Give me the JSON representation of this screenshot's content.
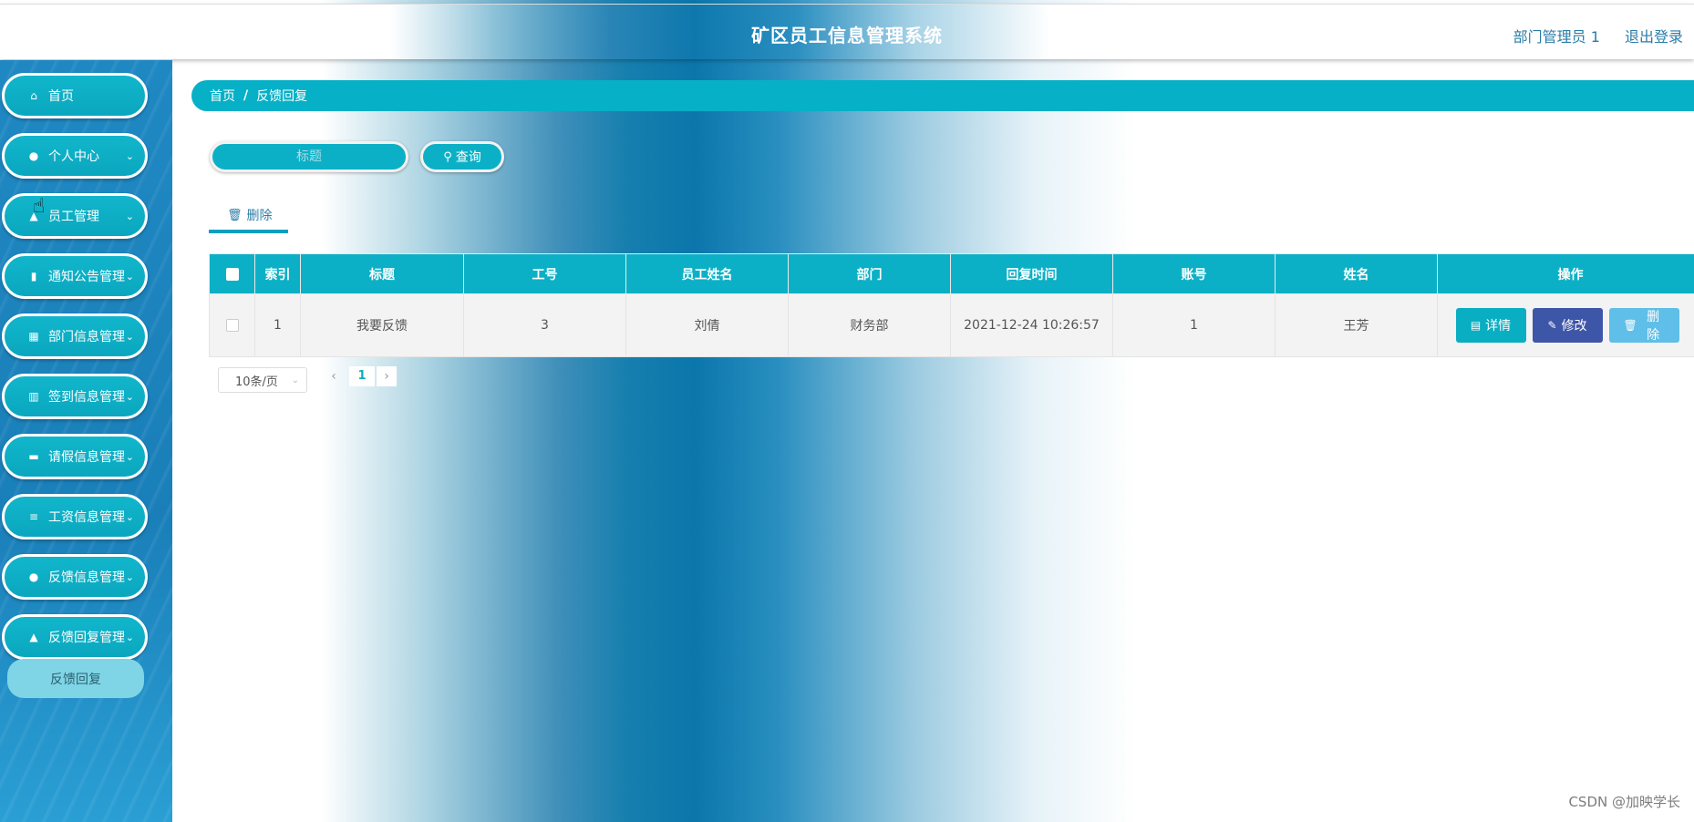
{
  "header": {
    "title": "矿区员工信息管理系统",
    "user": "部门管理员 1",
    "logout": "退出登录"
  },
  "sidebar": {
    "items": [
      {
        "label": "首页",
        "icon": "home-icon",
        "glyph": "⌂",
        "chevron": ""
      },
      {
        "label": "个人中心",
        "icon": "user-icon",
        "glyph": "●",
        "chevron": "⌄"
      },
      {
        "label": "员工管理",
        "icon": "users-icon",
        "glyph": "▲",
        "chevron": "⌄"
      },
      {
        "label": "通知公告管理",
        "icon": "clipboard-icon",
        "glyph": "▮",
        "chevron": "⌄"
      },
      {
        "label": "部门信息管理",
        "icon": "grid-icon",
        "glyph": "▦",
        "chevron": "⌄"
      },
      {
        "label": "签到信息管理",
        "icon": "bar-chart-icon",
        "glyph": "▥",
        "chevron": "⌄"
      },
      {
        "label": "请假信息管理",
        "icon": "briefcase-icon",
        "glyph": "▬",
        "chevron": "⌄"
      },
      {
        "label": "工资信息管理",
        "icon": "sliders-icon",
        "glyph": "≡",
        "chevron": "⌄"
      },
      {
        "label": "反馈信息管理",
        "icon": "bulb-icon",
        "glyph": "●",
        "chevron": "⌄"
      },
      {
        "label": "反馈回复管理",
        "icon": "person-icon",
        "glyph": "▲",
        "chevron": "⌄"
      }
    ],
    "submenu": {
      "label": "反馈回复"
    }
  },
  "breadcrumb": {
    "home": "首页",
    "separator": "/",
    "current": "反馈回复"
  },
  "search": {
    "placeholder": "标题",
    "value": "",
    "button_label": "查询"
  },
  "actions": {
    "delete_label": "删除"
  },
  "table": {
    "headers": [
      "索引",
      "标题",
      "工号",
      "员工姓名",
      "部门",
      "回复时间",
      "账号",
      "姓名",
      "操作"
    ],
    "rows": [
      {
        "index": "1",
        "title": "我要反馈",
        "employee_no": "3",
        "employee_name": "刘倩",
        "department": "财务部",
        "reply_time": "2021-12-24 10:26:57",
        "account": "1",
        "name": "王芳"
      }
    ],
    "row_actions": {
      "detail": "详情",
      "edit": "修改",
      "delete": "删除"
    }
  },
  "pagination": {
    "page_size": "10条/页",
    "current_page": "1"
  },
  "watermark": "CSDN @加映学长"
}
